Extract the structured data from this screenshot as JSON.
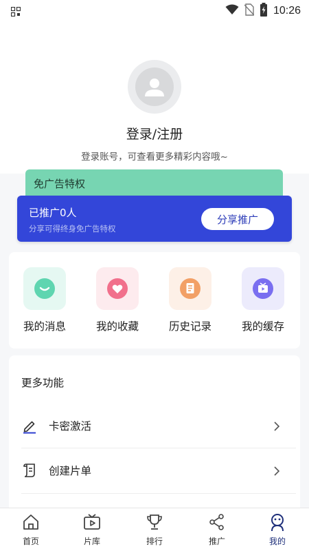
{
  "status_bar": {
    "time": "10:26",
    "icons": [
      "wifi-icon",
      "no-sim-icon",
      "battery-charging-icon"
    ]
  },
  "profile": {
    "avatar_icon": "user-avatar-icon",
    "login_title": "登录/注册",
    "login_subtitle": "登录账号，可查看更多精彩内容哦~"
  },
  "ad_card": {
    "title": "免广告特权",
    "color": "#77d5b2"
  },
  "promo_card": {
    "title": "已推广0人",
    "subtitle": "分享可得终身免广告特权",
    "share_button": "分享推广",
    "color": "#3346d9"
  },
  "quick_actions": [
    {
      "label": "我的消息",
      "icon": "message-icon"
    },
    {
      "label": "我的收藏",
      "icon": "heart-icon"
    },
    {
      "label": "历史记录",
      "icon": "history-icon"
    },
    {
      "label": "我的缓存",
      "icon": "cache-icon"
    }
  ],
  "more": {
    "title": "更多功能",
    "items": [
      {
        "label": "卡密激活",
        "icon": "pen-icon"
      },
      {
        "label": "创建片单",
        "icon": "scroll-icon"
      }
    ]
  },
  "bottom_nav": [
    {
      "label": "首页",
      "icon": "home-icon",
      "active": false
    },
    {
      "label": "片库",
      "icon": "tv-icon",
      "active": false
    },
    {
      "label": "排行",
      "icon": "trophy-icon",
      "active": false
    },
    {
      "label": "推广",
      "icon": "share-icon",
      "active": false
    },
    {
      "label": "我的",
      "icon": "profile-icon",
      "active": true
    }
  ],
  "colors": {
    "accent": "#3346d9",
    "active_nav": "#1e2f7a"
  }
}
